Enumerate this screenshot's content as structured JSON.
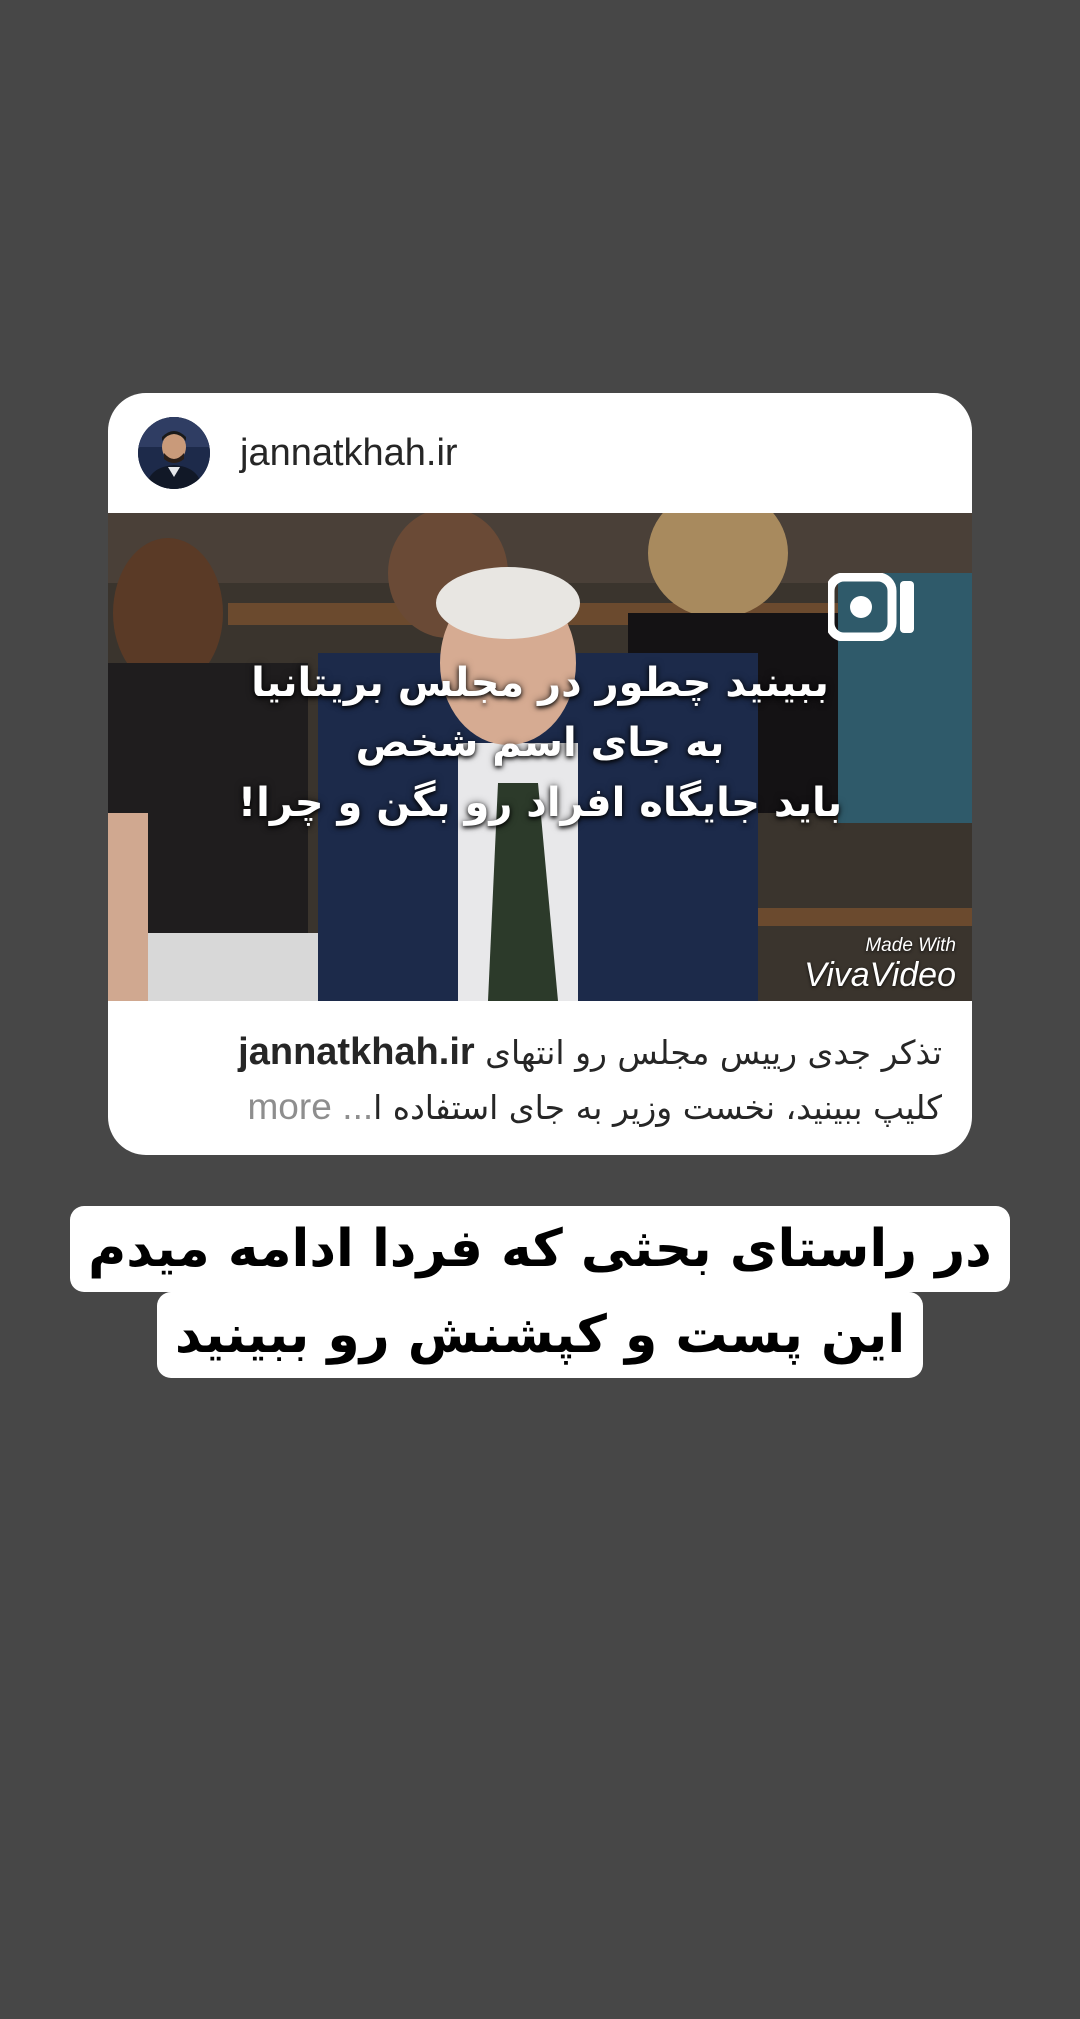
{
  "post": {
    "username": "jannatkhah.ir",
    "media": {
      "overlay_lines": [
        "ببینید چطور در مجلس بریتانیا",
        "به جای اسم شخص",
        "باید جایگاه افراد رو بگن و چرا!"
      ],
      "watermark_small": "Made With",
      "watermark_big": "VivaVideo",
      "type_icon": "igtv-icon"
    },
    "caption": {
      "username": "jannatkhah.ir",
      "line1_text": "تذکر جدی رییس مجلس رو انتهای",
      "line2_text": "کلیپ ببینید، نخست وزیر به جای استفاده ا",
      "ellipsis": "...",
      "more_label": "more"
    }
  },
  "story_text": {
    "line1": "در راستای بحثی که فردا ادامه میدم",
    "line2": "این پست و کپشنش رو ببینید"
  },
  "colors": {
    "background": "#474747",
    "card": "#ffffff",
    "text_primary": "#262626",
    "text_muted": "#8e8e8e"
  }
}
